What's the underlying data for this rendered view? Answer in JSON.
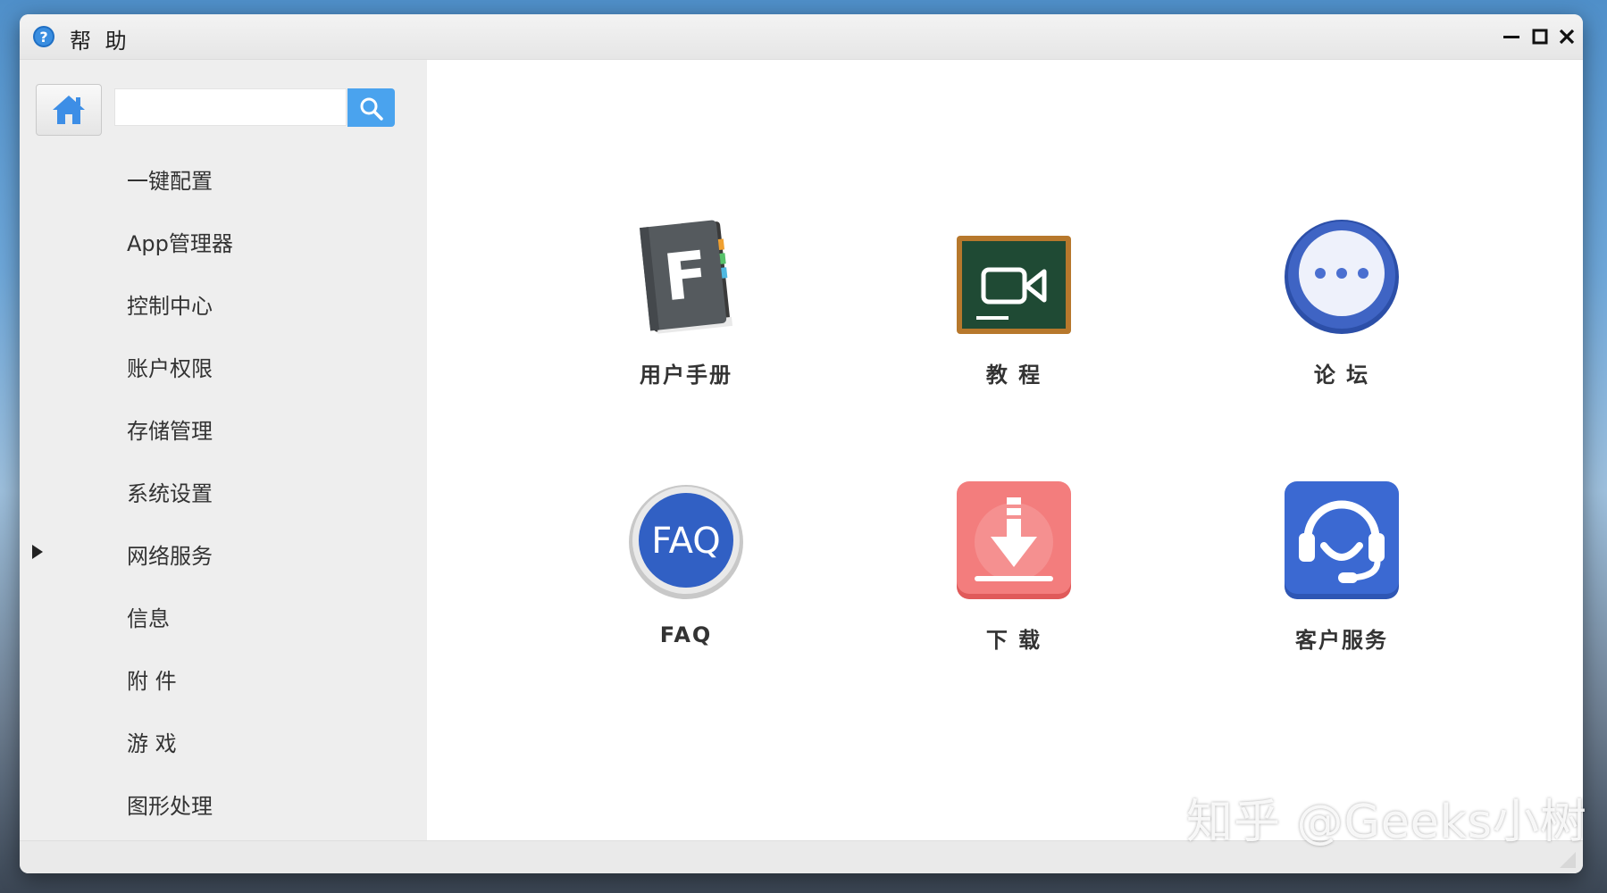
{
  "window": {
    "title": "帮 助"
  },
  "sidebar": {
    "search": {
      "value": "",
      "placeholder": ""
    },
    "items": [
      {
        "label": "一键配置"
      },
      {
        "label": "App管理器"
      },
      {
        "label": "控制中心"
      },
      {
        "label": "账户权限"
      },
      {
        "label": "存储管理"
      },
      {
        "label": "系统设置"
      },
      {
        "label": "网络服务",
        "expandable": true
      },
      {
        "label": "信息"
      },
      {
        "label": "附 件"
      },
      {
        "label": "游 戏"
      },
      {
        "label": "图形处理"
      }
    ]
  },
  "main": {
    "tiles": [
      {
        "label": "用户手册",
        "icon": "user-manual-book-icon"
      },
      {
        "label": "教 程",
        "icon": "tutorial-video-board-icon"
      },
      {
        "label": "论 坛",
        "icon": "forum-chat-bubble-icon"
      },
      {
        "label": "FAQ",
        "icon": "faq-icon",
        "icon_text": "FAQ"
      },
      {
        "label": "下 载",
        "icon": "download-icon"
      },
      {
        "label": "客户服务",
        "icon": "customer-service-headset-icon"
      }
    ]
  },
  "watermark": "知乎 @Geeks小树",
  "colors": {
    "accent": "#4aa3ee",
    "home_icon": "#3d8ee6",
    "forum_blue": "#3f64c4",
    "download_red": "#f06a6a",
    "service_blue": "#3b69d2",
    "chalkboard_green": "#1f4a34"
  }
}
